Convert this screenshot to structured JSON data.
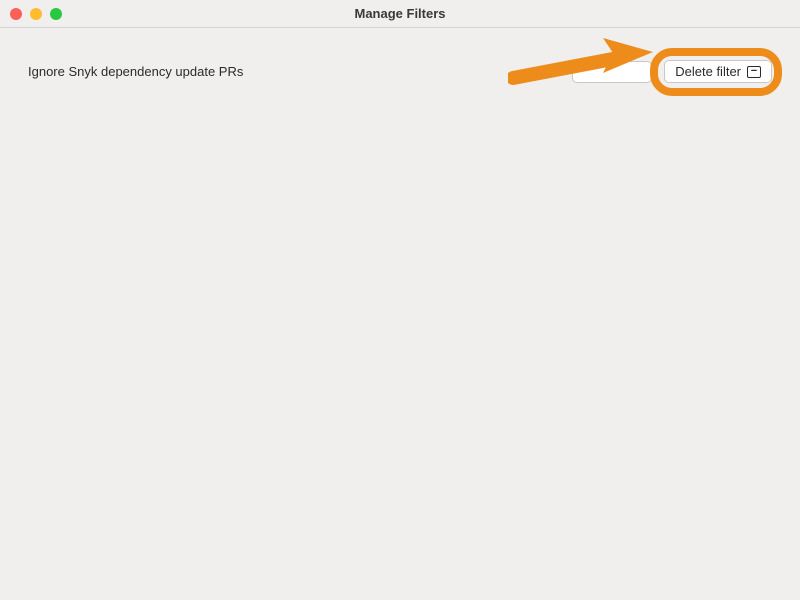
{
  "window": {
    "title": "Manage Filters"
  },
  "filter": {
    "name": "Ignore Snyk dependency update PRs"
  },
  "actions": {
    "delete_label": "Delete filter"
  },
  "annotation": {
    "color": "#ee8c1b"
  }
}
